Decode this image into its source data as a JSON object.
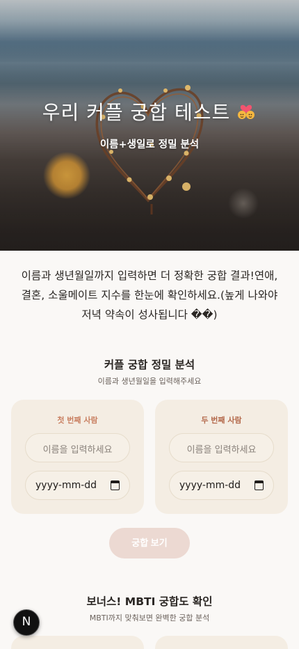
{
  "hero": {
    "title": "우리 커플 궁합 테스트",
    "emoji_icon": "couple-with-heart-icon",
    "subtitle": "이름+생일로 정밀 분석"
  },
  "intro": {
    "text": "이름과 생년월일까지 입력하면 더 정확한 궁합 결과!연애, 결혼, 소울메이트 지수를 한눈에 확인하세요.(높게 나와야 저녁 약속이 성사됩니다 ��)"
  },
  "precise": {
    "title": "커플 궁합 정밀 분석",
    "subtitle": "이름과 생년월일을 입력해주세요",
    "person1": {
      "label": "첫 번째 사람",
      "name_placeholder": "이름을 입력하세요",
      "date_value": "yyyy-mm-dd"
    },
    "person2": {
      "label": "두 번째 사람",
      "name_placeholder": "이름을 입력하세요",
      "date_value": "yyyy-mm-dd"
    },
    "button_label": "궁합 보기"
  },
  "bonus": {
    "title": "보너스! MBTI 궁합도 확인",
    "subtitle": "MBTI까지 맞춰보면 완벽한 궁합 분석"
  },
  "dev_badge": {
    "label": "N"
  },
  "colors": {
    "card_bg": "#f4ede3",
    "accent_label": "#c98062",
    "button_bg": "#ecd9d2"
  }
}
